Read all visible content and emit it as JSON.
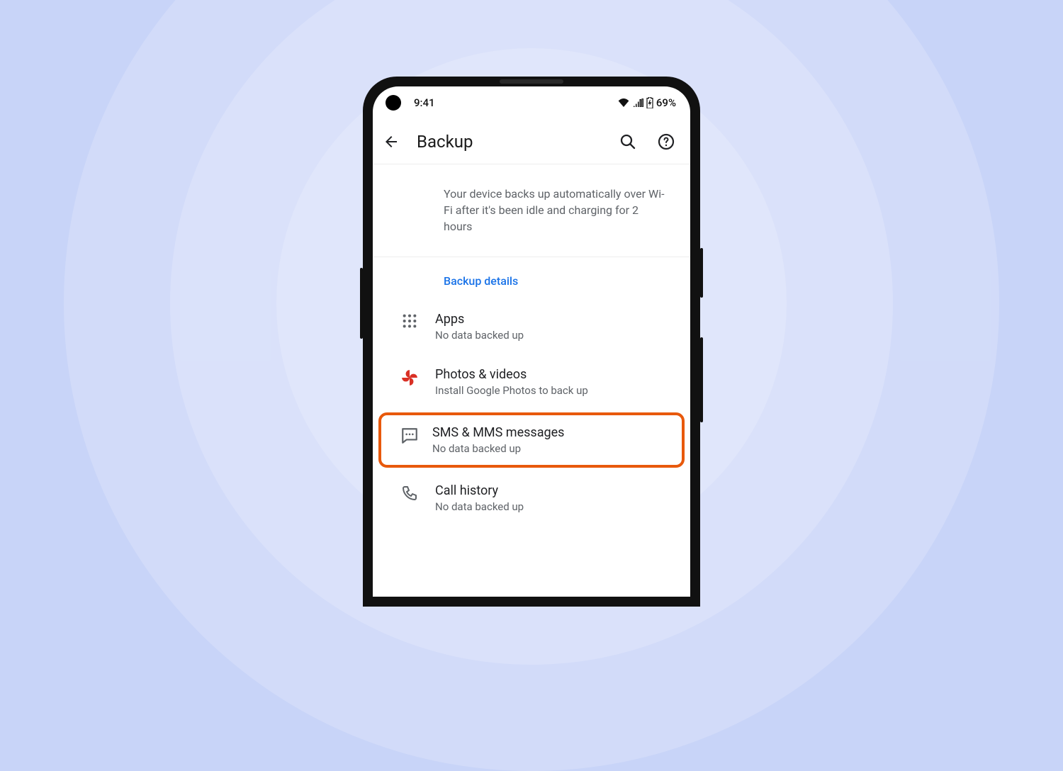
{
  "statusbar": {
    "time": "9:41",
    "battery_text": "69%"
  },
  "appbar": {
    "title": "Backup"
  },
  "info": {
    "text": "Your device backs up automatically over Wi-Fi after it's been idle and charging for 2 hours"
  },
  "section": {
    "label": "Backup details"
  },
  "items": {
    "apps": {
      "title": "Apps",
      "subtitle": "No data backed up"
    },
    "photos": {
      "title": "Photos & videos",
      "subtitle": "Install Google Photos to back up"
    },
    "sms": {
      "title": "SMS & MMS messages",
      "subtitle": "No data backed up"
    },
    "calls": {
      "title": "Call history",
      "subtitle": "No data backed up"
    }
  }
}
